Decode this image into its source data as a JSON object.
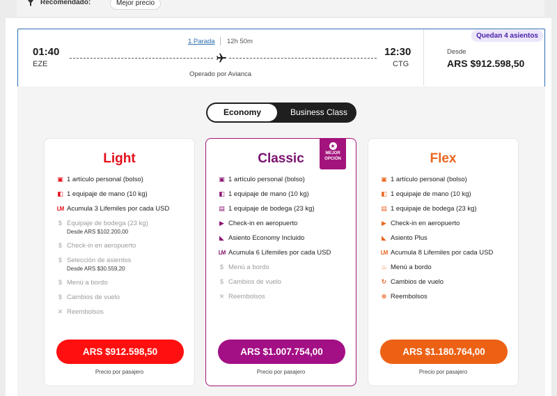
{
  "filter": {
    "label": "Recomendado:",
    "chip": "Mejor precio"
  },
  "flight": {
    "seats_badge": "Quedan 4 asientos",
    "departure_time": "01:40",
    "departure_code": "EZE",
    "arrival_time": "12:30",
    "arrival_code": "CTG",
    "stops": "1 Parada",
    "duration": "12h 50m",
    "operated_by": "Operado por Avianca",
    "from_label": "Desde",
    "from_price": "ARS $912.598,50"
  },
  "cabins": {
    "economy": "Economy",
    "business": "Business Class",
    "selected": "Economy"
  },
  "fares": [
    {
      "name": "Light",
      "color": "#e40d1a",
      "benefits": [
        {
          "icon": "bag-icon",
          "text": "1 artículo personal (bolso)",
          "included": true
        },
        {
          "icon": "carry-on-icon",
          "text": "1 equipaje de mano (10 kg)",
          "included": true
        },
        {
          "icon": "lifemiles-icon",
          "text": "Acumula 3 Lifemiles por cada USD",
          "included": true
        },
        {
          "icon": "dollar-icon",
          "text": "Equipaje de bodega (23 kg)",
          "sub": "Desde ARS $102.200,00",
          "included": false
        },
        {
          "icon": "dollar-icon",
          "text": "Check-in en aeropuerto",
          "included": false
        },
        {
          "icon": "dollar-icon",
          "text": "Selección de asientos",
          "sub": "Desde ARS $30.559,20",
          "included": false
        },
        {
          "icon": "dollar-icon",
          "text": "Menú a bordo",
          "included": false
        },
        {
          "icon": "dollar-icon",
          "text": "Cambios de vuelo",
          "included": false
        },
        {
          "icon": "x-icon",
          "text": "Reembolsos",
          "included": false
        }
      ],
      "price": "ARS  $912.598,50",
      "per_passenger": "Precio por pasajero"
    },
    {
      "name": "Classic",
      "color": "#7a1170",
      "badge": [
        "MEJOR",
        "OPCIÓN"
      ],
      "benefits": [
        {
          "icon": "bag-icon",
          "text": "1 artículo personal (bolso)",
          "included": true
        },
        {
          "icon": "carry-on-icon",
          "text": "1 equipaje de mano (10 kg)",
          "included": true
        },
        {
          "icon": "checked-bag-icon",
          "text": "1 equipaje de bodega (23 kg)",
          "included": true
        },
        {
          "icon": "checkin-icon",
          "text": "Check-in en aeropuerto",
          "included": true
        },
        {
          "icon": "seat-icon",
          "text": "Asiento Economy Incluido",
          "included": true
        },
        {
          "icon": "lifemiles-icon",
          "text": "Acumula 6 Lifemiles por cada USD",
          "included": true
        },
        {
          "icon": "dollar-icon",
          "text": "Menú a bordo",
          "included": false
        },
        {
          "icon": "dollar-icon",
          "text": "Cambios de vuelo",
          "included": false
        },
        {
          "icon": "x-icon",
          "text": "Reembolsos",
          "included": false
        }
      ],
      "price": "ARS  $1.007.754,00",
      "per_passenger": "Precio por pasajero"
    },
    {
      "name": "Flex",
      "color": "#e8661e",
      "benefits": [
        {
          "icon": "bag-icon",
          "text": "1 artículo personal (bolso)",
          "included": true
        },
        {
          "icon": "carry-on-icon",
          "text": "1 equipaje de mano (10 kg)",
          "included": true
        },
        {
          "icon": "checked-bag-icon",
          "text": "1 equipaje de bodega (23 kg)",
          "included": true
        },
        {
          "icon": "checkin-icon",
          "text": "Check-in en aeropuerto",
          "included": true
        },
        {
          "icon": "seat-icon",
          "text": "Asiento Plus",
          "included": true
        },
        {
          "icon": "lifemiles-icon",
          "text": "Acumula 8 Lifemiles por cada USD",
          "included": true
        },
        {
          "icon": "meal-icon",
          "text": "Menú a bordo",
          "included": true
        },
        {
          "icon": "change-icon",
          "text": "Cambios de vuelo",
          "included": true
        },
        {
          "icon": "refund-icon",
          "text": "Reembolsos",
          "included": true
        }
      ],
      "price": "ARS  $1.180.764,00",
      "per_passenger": "Precio por pasajero"
    }
  ]
}
